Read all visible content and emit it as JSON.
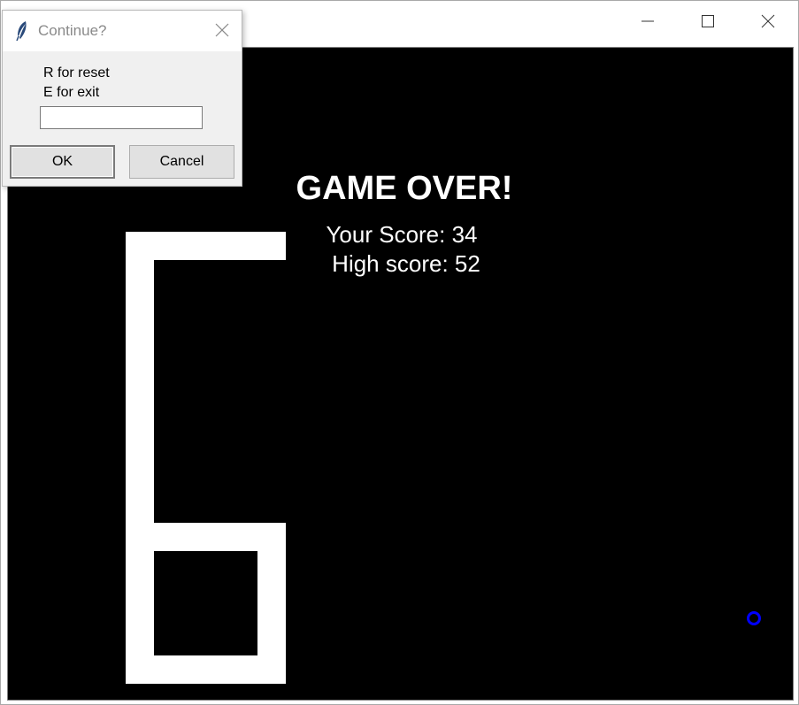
{
  "dialog": {
    "title": "Continue?",
    "prompt_lines": "R for reset\nE for exit",
    "input_value": "",
    "ok_label": "OK",
    "cancel_label": "Cancel"
  },
  "game": {
    "title": "GAME OVER!",
    "score_text": "Your Score: 34",
    "high_score_text": "High score: 52",
    "background_color": "#000000",
    "snake_color": "#ffffff",
    "food_color": "#0000ff"
  },
  "window_controls": {
    "minimize_icon": "minimize-icon",
    "maximize_icon": "maximize-icon",
    "close_icon": "close-icon"
  }
}
